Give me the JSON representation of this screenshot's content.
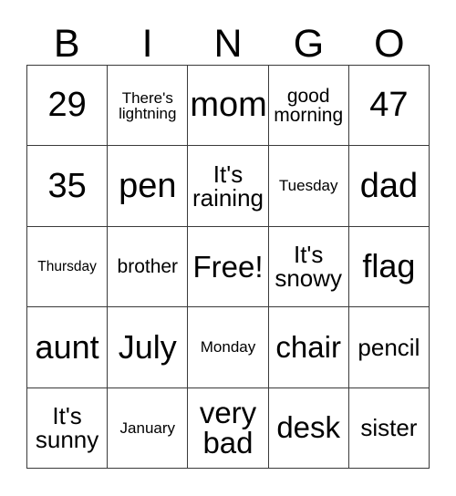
{
  "card": {
    "title": "BINGO",
    "header_letters": [
      "B",
      "I",
      "N",
      "G",
      "O"
    ],
    "colors": {
      "background": "#ffffff",
      "text": "#000000",
      "border": "#3a3a3a"
    },
    "free_space": "Free!",
    "grid": {
      "columns": 5,
      "rows": 5,
      "cells": [
        {
          "text": "29",
          "size": "fs-xl",
          "row": 1,
          "col": 1
        },
        {
          "text": "There's\nlightning",
          "size": "fs-xxs",
          "row": 1,
          "col": 2
        },
        {
          "text": "mom",
          "size": "fs-xl",
          "row": 1,
          "col": 3
        },
        {
          "text": "good\nmorning",
          "size": "fs-xs",
          "row": 1,
          "col": 4
        },
        {
          "text": "47",
          "size": "fs-xl",
          "row": 1,
          "col": 5
        },
        {
          "text": "35",
          "size": "fs-xl",
          "row": 2,
          "col": 1
        },
        {
          "text": "pen",
          "size": "fs-xl",
          "row": 2,
          "col": 2
        },
        {
          "text": "It's\nraining",
          "size": "fs-sm",
          "row": 2,
          "col": 3
        },
        {
          "text": "Tuesday",
          "size": "fs-xxs",
          "row": 2,
          "col": 4
        },
        {
          "text": "dad",
          "size": "fs-xl",
          "row": 2,
          "col": 5
        },
        {
          "text": "Thursday",
          "size": "fs-tiny",
          "row": 3,
          "col": 1
        },
        {
          "text": "brother",
          "size": "fs-xs",
          "row": 3,
          "col": 2
        },
        {
          "text": "Free!",
          "size": "fs-md",
          "row": 3,
          "col": 3
        },
        {
          "text": "It's\nsnowy",
          "size": "fs-sm",
          "row": 3,
          "col": 4
        },
        {
          "text": "flag",
          "size": "fs-lg",
          "row": 3,
          "col": 5
        },
        {
          "text": "aunt",
          "size": "fs-lg",
          "row": 4,
          "col": 1
        },
        {
          "text": "July",
          "size": "fs-lg",
          "row": 4,
          "col": 2
        },
        {
          "text": "Monday",
          "size": "fs-xxs",
          "row": 4,
          "col": 3
        },
        {
          "text": "chair",
          "size": "fs-md",
          "row": 4,
          "col": 4
        },
        {
          "text": "pencil",
          "size": "fs-sm",
          "row": 4,
          "col": 5
        },
        {
          "text": "It's\nsunny",
          "size": "fs-sm",
          "row": 5,
          "col": 1
        },
        {
          "text": "January",
          "size": "fs-xxs",
          "row": 5,
          "col": 2
        },
        {
          "text": "very\nbad",
          "size": "fs-md",
          "row": 5,
          "col": 3
        },
        {
          "text": "desk",
          "size": "fs-md",
          "row": 5,
          "col": 4
        },
        {
          "text": "sister",
          "size": "fs-sm",
          "row": 5,
          "col": 5
        }
      ]
    }
  }
}
